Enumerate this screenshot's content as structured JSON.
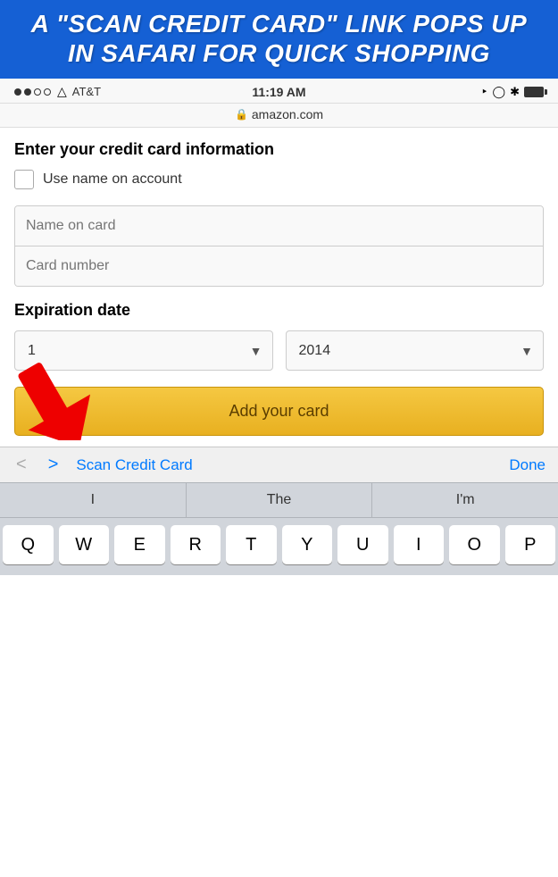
{
  "banner": {
    "line1": "A \"SCAN CREDIT CARD\" LINK  POPS UP",
    "line2": "IN SAFARI FOR QUICK SHOPPING"
  },
  "status_bar": {
    "carrier": "AT&T",
    "time": "11:19 AM",
    "url": "amazon.com"
  },
  "form": {
    "section_title": "Enter your credit card information",
    "checkbox_label": "Use name on account",
    "name_placeholder": "Name on card",
    "card_placeholder": "Card number",
    "expiry_label": "Expiration date",
    "month_value": "1",
    "year_value": "2014",
    "add_card_btn": "Add your card"
  },
  "toolbar": {
    "scan_link": "Scan Credit Card",
    "done_btn": "Done"
  },
  "autocomplete": {
    "items": [
      "I",
      "The",
      "I'm"
    ]
  },
  "keyboard": {
    "rows": [
      [
        "Q",
        "W",
        "E",
        "R",
        "T",
        "Y",
        "U",
        "I",
        "O",
        "P"
      ]
    ]
  }
}
